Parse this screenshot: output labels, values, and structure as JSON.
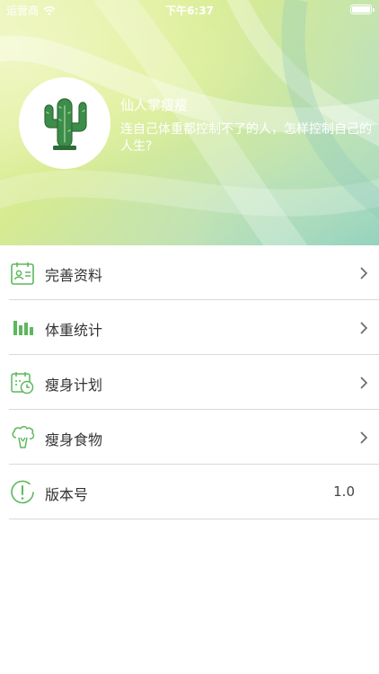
{
  "status_bar": {
    "carrier": "运营商",
    "time": "下午6:37"
  },
  "profile": {
    "name": "仙人掌瘦瘦",
    "motto": "连自己体重都控制不了的人，怎样控制自己的人生?",
    "avatar_icon": "cactus-icon"
  },
  "menu": {
    "items": [
      {
        "label": "完善资料",
        "icon": "profile-card-icon"
      },
      {
        "label": "体重统计",
        "icon": "bar-chart-icon"
      },
      {
        "label": "瘦身计划",
        "icon": "calendar-clock-icon"
      },
      {
        "label": "瘦身食物",
        "icon": "broccoli-icon"
      },
      {
        "label": "版本号",
        "icon": "info-icon",
        "value": "1.0"
      }
    ]
  },
  "colors": {
    "accent_green": "#5cb85c",
    "cactus_green": "#3c8c4a"
  }
}
